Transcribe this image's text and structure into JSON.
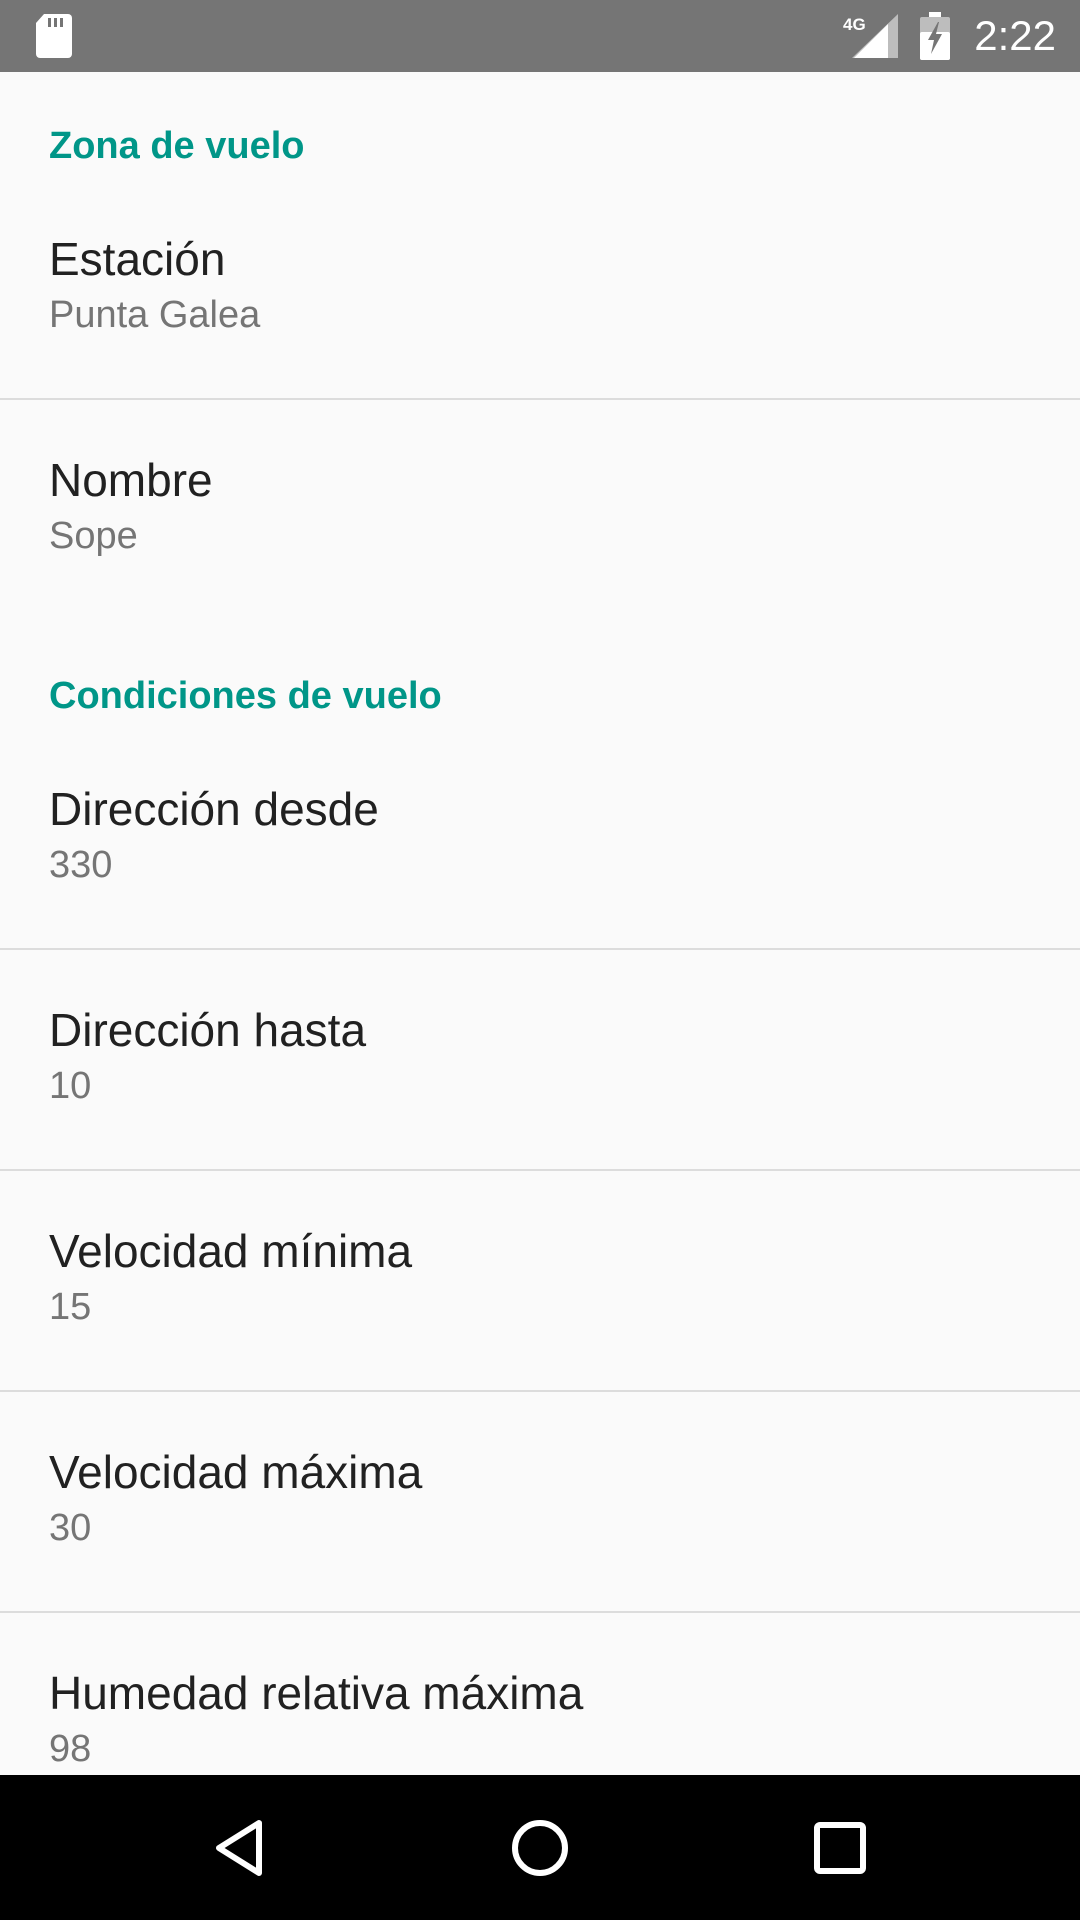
{
  "status_bar": {
    "network_label": "4G",
    "time": "2:22",
    "icons": [
      "sd-card-icon",
      "signal-icon",
      "battery-charging-icon"
    ]
  },
  "sections": [
    {
      "header": "Zona de vuelo",
      "items": [
        {
          "title": "Estación",
          "summary": "Punta Galea"
        },
        {
          "title": "Nombre",
          "summary": "Sope"
        }
      ]
    },
    {
      "header": "Condiciones de vuelo",
      "items": [
        {
          "title": "Dirección desde",
          "summary": "330"
        },
        {
          "title": "Dirección hasta",
          "summary": "10"
        },
        {
          "title": "Velocidad mínima",
          "summary": "15"
        },
        {
          "title": "Velocidad máxima",
          "summary": "30"
        },
        {
          "title": "Humedad relativa máxima",
          "summary": "98"
        }
      ]
    }
  ],
  "nav_bar": {
    "icons": [
      "back-icon",
      "home-icon",
      "recents-icon"
    ]
  },
  "colors": {
    "accent": "#009688",
    "status_bar": "#757575",
    "background": "#fafafa",
    "nav_bar": "#000000"
  }
}
